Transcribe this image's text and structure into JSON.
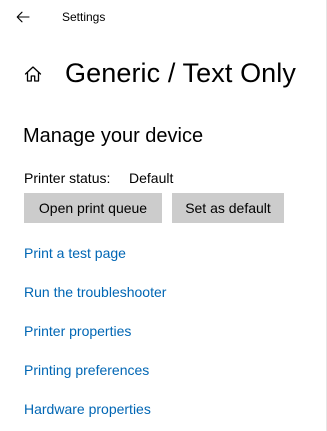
{
  "window": {
    "title": "Settings"
  },
  "header": {
    "title": "Generic / Text Only"
  },
  "section": {
    "title": "Manage your device"
  },
  "printer_status": {
    "label": "Printer status:",
    "value": "Default"
  },
  "buttons": {
    "open_queue": "Open print queue",
    "set_default": "Set as default"
  },
  "links": [
    {
      "label": "Print a test page"
    },
    {
      "label": "Run the troubleshooter"
    },
    {
      "label": "Printer properties"
    },
    {
      "label": "Printing preferences"
    },
    {
      "label": "Hardware properties"
    }
  ],
  "icons": {
    "back": "back-arrow-icon",
    "home": "home-icon"
  },
  "colors": {
    "link": "#0066b4",
    "button_bg": "#cccccc",
    "background": "#ffffff"
  }
}
